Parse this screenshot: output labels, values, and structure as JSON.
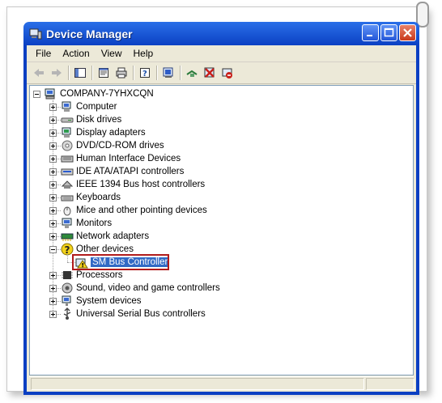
{
  "window": {
    "title": "Device Manager"
  },
  "menu": [
    "File",
    "Action",
    "View",
    "Help"
  ],
  "toolbar": [
    {
      "icon": "back-arrow-icon"
    },
    {
      "icon": "forward-arrow-icon"
    },
    {
      "icon": "show-hide-console-tree-icon"
    },
    {
      "icon": "properties-icon"
    },
    {
      "icon": "print-icon"
    },
    {
      "icon": "help-icon"
    },
    {
      "icon": "scan-hardware-icon"
    },
    {
      "icon": "update-driver-icon"
    },
    {
      "icon": "uninstall-icon"
    },
    {
      "icon": "disable-device-icon"
    }
  ],
  "tree": {
    "root": "COMPANY-7YHXCQN",
    "items": [
      {
        "label": "Computer",
        "icon": "computer-icon"
      },
      {
        "label": "Disk drives",
        "icon": "disk-drive-icon"
      },
      {
        "label": "Display adapters",
        "icon": "display-adapter-icon"
      },
      {
        "label": "DVD/CD-ROM drives",
        "icon": "dvd-drive-icon"
      },
      {
        "label": "Human Interface Devices",
        "icon": "hid-icon"
      },
      {
        "label": "IDE ATA/ATAPI controllers",
        "icon": "ide-controller-icon"
      },
      {
        "label": "IEEE 1394 Bus host controllers",
        "icon": "firewire-icon"
      },
      {
        "label": "Keyboards",
        "icon": "keyboard-icon"
      },
      {
        "label": "Mice and other pointing devices",
        "icon": "mouse-icon"
      },
      {
        "label": "Monitors",
        "icon": "monitor-icon"
      },
      {
        "label": "Network adapters",
        "icon": "network-adapter-icon"
      },
      {
        "label": "Other devices",
        "icon": "unknown-device-icon",
        "expanded": true
      },
      {
        "label": "Processors",
        "icon": "processor-icon"
      },
      {
        "label": "Sound, video and game controllers",
        "icon": "sound-icon"
      },
      {
        "label": "System devices",
        "icon": "system-devices-icon"
      },
      {
        "label": "Universal Serial Bus controllers",
        "icon": "usb-icon"
      }
    ],
    "other_devices_child": {
      "label": "SM Bus Controller",
      "icon": "warning-device-icon",
      "selected": true
    }
  },
  "colors": {
    "accent": "#316ac5",
    "highlight_border": "#b01b1b",
    "titlebar": "#0a3fc2"
  }
}
